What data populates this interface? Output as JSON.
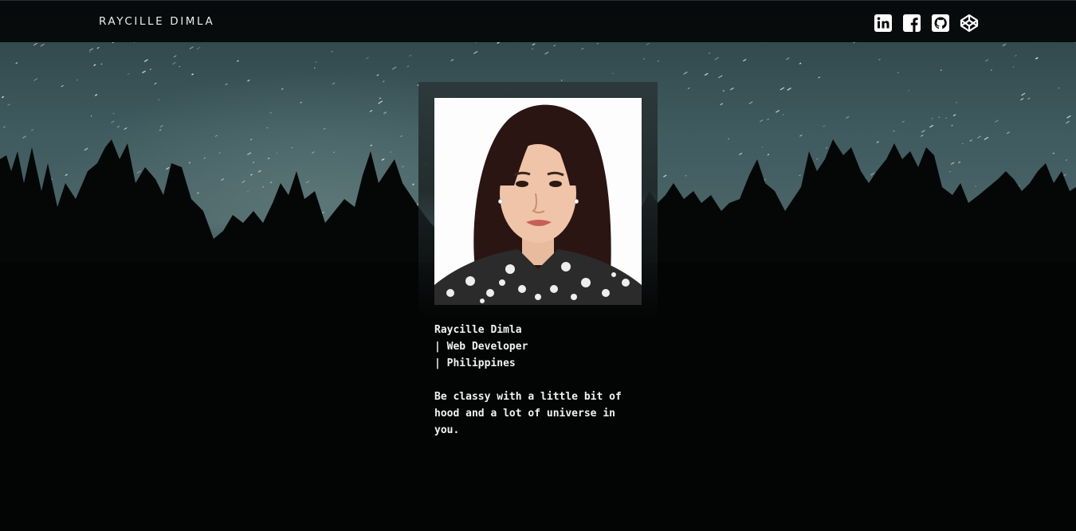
{
  "navbar": {
    "brand": "RAYCILLE DIMLA",
    "social_icons": [
      "linkedin-icon",
      "facebook-icon",
      "github-icon",
      "codepen-icon"
    ]
  },
  "profile": {
    "name": "Raycille Dimla",
    "role": "| Web Developer",
    "location": "| Philippines",
    "quote": "Be classy with a little bit of hood and a lot of universe in you."
  },
  "colors": {
    "navbar_bg": "#060809",
    "sky": "#3f5a5e",
    "forest": "#020303",
    "frame": "#2c383a",
    "text": "#ffffff"
  }
}
